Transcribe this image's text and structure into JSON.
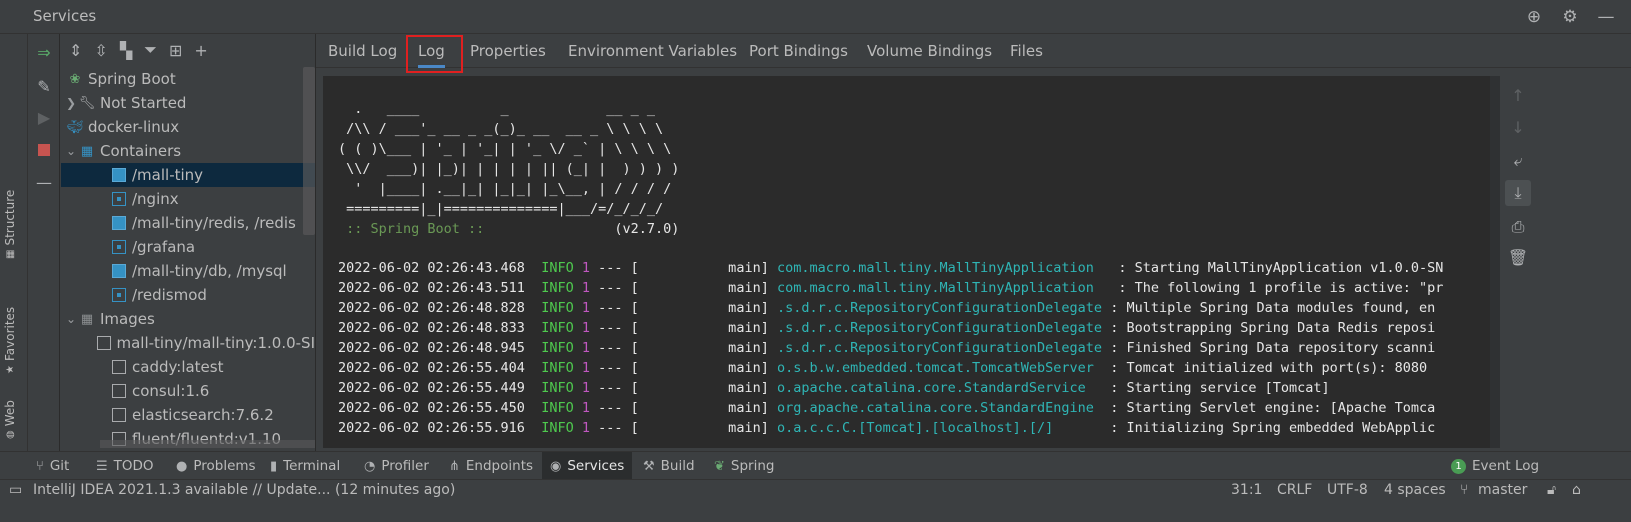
{
  "window": {
    "title": "Services"
  },
  "title_icons": [
    "target-icon",
    "gear-icon",
    "minimize-icon"
  ],
  "left_strip": {
    "tabs": [
      "Structure",
      "Favorites",
      "Web"
    ]
  },
  "tree": {
    "items": [
      {
        "label": "Spring Boot",
        "level": 0,
        "icon": "spring-boot-icon"
      },
      {
        "label": "Not Started",
        "level": 1,
        "icon": "wrench-icon",
        "arrow": "collapsed"
      },
      {
        "label": "docker-linux",
        "level": 0,
        "icon": "docker-icon"
      },
      {
        "label": "Containers",
        "level": 1,
        "icon": "containers-icon",
        "arrow": "expanded"
      },
      {
        "label": "/mall-tiny",
        "level": 2,
        "icon": "container-running-icon",
        "selected": true
      },
      {
        "label": "/nginx",
        "level": 2,
        "icon": "container-stopped-icon"
      },
      {
        "label": "/mall-tiny/redis, /redis",
        "level": 2,
        "icon": "container-running-icon"
      },
      {
        "label": "/grafana",
        "level": 2,
        "icon": "container-stopped-icon"
      },
      {
        "label": "/mall-tiny/db, /mysql",
        "level": 2,
        "icon": "container-running-icon"
      },
      {
        "label": "/redismod",
        "level": 2,
        "icon": "container-stopped-icon"
      },
      {
        "label": "Images",
        "level": 1,
        "icon": "images-icon",
        "arrow": "expanded"
      },
      {
        "label": "mall-tiny/mall-tiny:1.0.0-SI",
        "level": 2,
        "icon": "image-icon"
      },
      {
        "label": "caddy:latest",
        "level": 2,
        "icon": "image-icon"
      },
      {
        "label": "consul:1.6",
        "level": 2,
        "icon": "image-icon"
      },
      {
        "label": "elasticsearch:7.6.2",
        "level": 2,
        "icon": "image-icon"
      },
      {
        "label": "fluent/fluentd:v1.10",
        "level": 2,
        "icon": "image-icon"
      }
    ]
  },
  "tabs": {
    "items": [
      "Build Log",
      "Log",
      "Properties",
      "Environment Variables",
      "Port Bindings",
      "Volume Bindings",
      "Files"
    ],
    "active": "Log"
  },
  "console": {
    "banner": [
      "  .   ____          _            __ _ _",
      " /\\\\ / ___'_ __ _ _(_)_ __  __ _ \\ \\ \\ \\",
      "( ( )\\___ | '_ | '_| | '_ \\/ _` | \\ \\ \\ \\",
      " \\\\/  ___)| |_)| | | | | || (_| |  ) ) ) )",
      "  '  |____| .__|_| |_|_| |_\\__, | / / / /",
      " =========|_|==============|___/=/_/_/_/"
    ],
    "spring_tag": " :: Spring Boot :: ",
    "spring_version": "               (v2.7.0)",
    "lines": [
      {
        "ts": "2022-06-02 02:26:43.468",
        "level": "INFO",
        "pid": "1",
        "sep": " --- [",
        "thread": "           main] ",
        "logger": "com.macro.mall.tiny.MallTinyApplication  ",
        "msg": " : Starting MallTinyApplication v1.0.0-SN"
      },
      {
        "ts": "2022-06-02 02:26:43.511",
        "level": "INFO",
        "pid": "1",
        "sep": " --- [",
        "thread": "           main] ",
        "logger": "com.macro.mall.tiny.MallTinyApplication  ",
        "msg": " : The following 1 profile is active: \"pr"
      },
      {
        "ts": "2022-06-02 02:26:48.828",
        "level": "INFO",
        "pid": "1",
        "sep": " --- [",
        "thread": "           main] ",
        "logger": ".s.d.r.c.RepositoryConfigurationDelegate",
        "msg": " : Multiple Spring Data modules found, en"
      },
      {
        "ts": "2022-06-02 02:26:48.833",
        "level": "INFO",
        "pid": "1",
        "sep": " --- [",
        "thread": "           main] ",
        "logger": ".s.d.r.c.RepositoryConfigurationDelegate",
        "msg": " : Bootstrapping Spring Data Redis reposi"
      },
      {
        "ts": "2022-06-02 02:26:48.945",
        "level": "INFO",
        "pid": "1",
        "sep": " --- [",
        "thread": "           main] ",
        "logger": ".s.d.r.c.RepositoryConfigurationDelegate",
        "msg": " : Finished Spring Data repository scanni"
      },
      {
        "ts": "2022-06-02 02:26:55.404",
        "level": "INFO",
        "pid": "1",
        "sep": " --- [",
        "thread": "           main] ",
        "logger": "o.s.b.w.embedded.tomcat.TomcatWebServer ",
        "msg": " : Tomcat initialized with port(s): 8080"
      },
      {
        "ts": "2022-06-02 02:26:55.449",
        "level": "INFO",
        "pid": "1",
        "sep": " --- [",
        "thread": "           main] ",
        "logger": "o.apache.catalina.core.StandardService  ",
        "msg": " : Starting service [Tomcat]"
      },
      {
        "ts": "2022-06-02 02:26:55.450",
        "level": "INFO",
        "pid": "1",
        "sep": " --- [",
        "thread": "           main] ",
        "logger": "org.apache.catalina.core.StandardEngine ",
        "msg": " : Starting Servlet engine: [Apache Tomca"
      },
      {
        "ts": "2022-06-02 02:26:55.916",
        "level": "INFO",
        "pid": "1",
        "sep": " --- [",
        "thread": "           main] ",
        "logger": "o.a.c.c.C.[Tomcat].[localhost].[/]      ",
        "msg": " : Initializing Spring embedded WebApplic"
      }
    ]
  },
  "bottom_tabs": {
    "items": [
      "Git",
      "TODO",
      "Problems",
      "Terminal",
      "Profiler",
      "Endpoints",
      "Services",
      "Build",
      "Spring"
    ],
    "active": "Services",
    "event_log": {
      "count": "1",
      "label": "Event Log"
    }
  },
  "status": {
    "message": "IntelliJ IDEA 2021.1.3 available // Update... (12 minutes ago)",
    "position": "31:1",
    "line_sep": "CRLF",
    "encoding": "UTF-8",
    "indent": "4 spaces",
    "branch": "master"
  },
  "colors": {
    "accent": "#4a88c7",
    "selection": "#0d293e",
    "container": "#3592c4",
    "log_info": "#4ec94e",
    "log_pid": "#c058c0",
    "log_logger": "#2fb5b5",
    "highlight_box": "#e02020"
  }
}
